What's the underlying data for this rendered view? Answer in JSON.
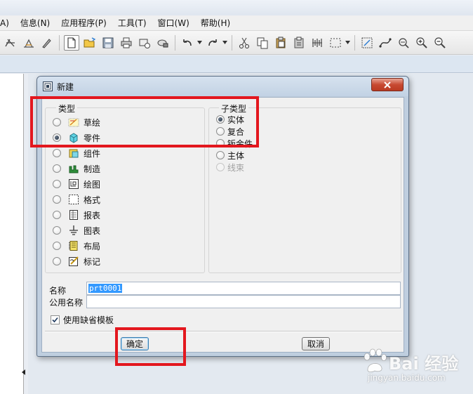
{
  "menubar": {
    "items": [
      {
        "label": "A)"
      },
      {
        "label": "信息(N)"
      },
      {
        "label": "应用程序(P)"
      },
      {
        "label": "工具(T)"
      },
      {
        "label": "窗口(W)"
      },
      {
        "label": "帮助(H)"
      }
    ]
  },
  "toolbar": {
    "icons": [
      "spline-icon",
      "sketch-dimension-icon",
      "pen-icon",
      "new-file-icon",
      "open-folder-icon",
      "save-icon",
      "print-icon",
      "send-mail-icon",
      "lock-icon",
      "undo-icon",
      "redo-icon",
      "cut-icon",
      "copy-icon",
      "paste-icon",
      "paste-special-icon",
      "regenerate-icon",
      "select-box-icon",
      "refit-icon",
      "datum-curve-icon",
      "view-manager-icon",
      "zoom-in-icon",
      "zoom-out-icon"
    ]
  },
  "dialog": {
    "title": "新建",
    "type_group": {
      "label": "类型",
      "options": [
        {
          "label": "草绘",
          "icon": "sketch-icon",
          "selected": false
        },
        {
          "label": "零件",
          "icon": "part-icon",
          "selected": true
        },
        {
          "label": "组件",
          "icon": "assembly-icon",
          "selected": false
        },
        {
          "label": "制造",
          "icon": "manufacturing-icon",
          "selected": false
        },
        {
          "label": "绘图",
          "icon": "drawing-icon",
          "selected": false
        },
        {
          "label": "格式",
          "icon": "format-icon",
          "selected": false
        },
        {
          "label": "报表",
          "icon": "report-icon",
          "selected": false
        },
        {
          "label": "图表",
          "icon": "diagram-icon",
          "selected": false
        },
        {
          "label": "布局",
          "icon": "layout-icon",
          "selected": false
        },
        {
          "label": "标记",
          "icon": "markup-icon",
          "selected": false
        }
      ]
    },
    "subtype_group": {
      "label": "子类型",
      "options": [
        {
          "label": "实体",
          "selected": true,
          "enabled": true
        },
        {
          "label": "复合",
          "selected": false,
          "enabled": true
        },
        {
          "label": "钣金件",
          "selected": false,
          "enabled": true
        },
        {
          "label": "主体",
          "selected": false,
          "enabled": true
        },
        {
          "label": "线束",
          "selected": false,
          "enabled": false
        }
      ]
    },
    "name_label": "名称",
    "name_value": "prt0001",
    "common_name_label": "公用名称",
    "common_name_value": "",
    "use_default_template_label": "使用缺省模板",
    "use_default_template_checked": true,
    "ok_label": "确定",
    "cancel_label": "取消"
  },
  "watermark": {
    "brand": "Bai 经验",
    "url": "jingyan.baidu.com"
  },
  "colors": {
    "annotation_red": "#e3171e",
    "dialog_frame": "#bfcedf",
    "selection_blue": "#3399ff"
  }
}
